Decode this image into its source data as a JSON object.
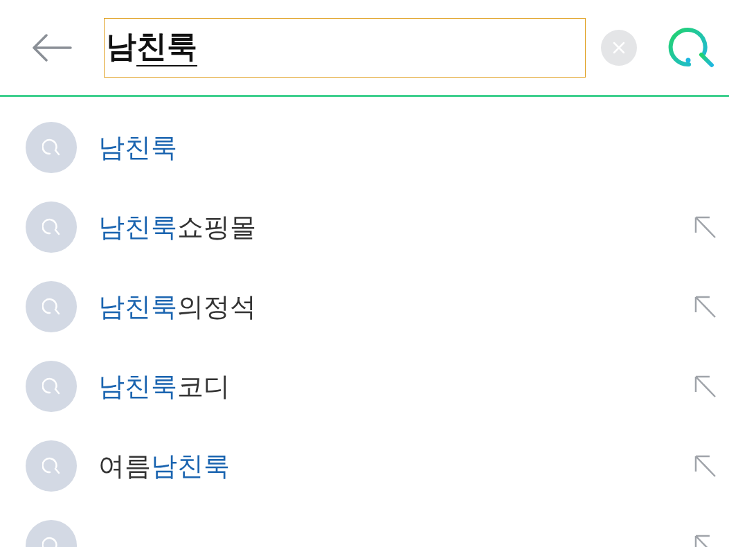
{
  "search": {
    "query": [
      {
        "text": "남",
        "composing": false
      },
      {
        "text": "친룩",
        "composing": true
      }
    ]
  },
  "suggestions": [
    {
      "parts": [
        {
          "text": "남친룩",
          "match": true
        }
      ],
      "fill_arrow": false
    },
    {
      "parts": [
        {
          "text": "남친룩",
          "match": true
        },
        {
          "text": "쇼핑몰",
          "match": false
        }
      ],
      "fill_arrow": true
    },
    {
      "parts": [
        {
          "text": "남친룩",
          "match": true
        },
        {
          "text": "의정석",
          "match": false
        }
      ],
      "fill_arrow": true
    },
    {
      "parts": [
        {
          "text": "남친룩",
          "match": true
        },
        {
          "text": "코디",
          "match": false
        }
      ],
      "fill_arrow": true
    },
    {
      "parts": [
        {
          "text": "여름",
          "match": false
        },
        {
          "text": "남친룩",
          "match": true
        }
      ],
      "fill_arrow": true
    },
    {
      "fill_arrow": true
    }
  ]
}
